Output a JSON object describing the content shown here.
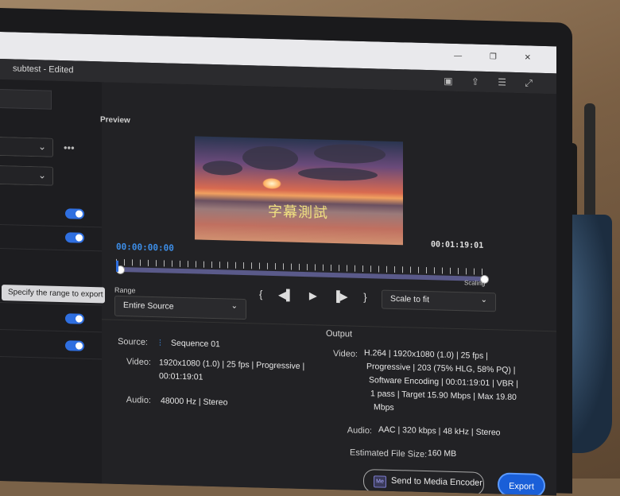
{
  "app": {
    "title": "subtest - Edited"
  },
  "preview": {
    "label": "Preview",
    "subtitle": "字幕測試",
    "timecode_current": "00:00:00:00",
    "timecode_duration": "00:01:19:01",
    "scaling_label": "Scaling"
  },
  "range": {
    "label": "Range",
    "value": "Entire Source"
  },
  "scale": {
    "value": "Scale to fit"
  },
  "tooltip": "Specify the range to export",
  "source": {
    "source_label": "Source:",
    "sequence": "Sequence 01",
    "video_label": "Video:",
    "video_line1": "1920x1080 (1.0) | 25 fps | Progressive |",
    "video_line2": "00:01:19:01",
    "audio_label": "Audio:",
    "audio": "48000 Hz | Stereo"
  },
  "output": {
    "title": "Output",
    "video_label": "Video:",
    "video_lines": [
      "H.264 | 1920x1080 (1.0) | 25 fps |",
      "Progressive | 203 (75% HLG, 58% PQ) |",
      "Software Encoding | 00:01:19:01 | VBR |",
      "1 pass | Target 15.90 Mbps | Max 19.80",
      "Mbps"
    ],
    "audio_label": "Audio:",
    "audio": "AAC | 320 kbps | 48 kHz | Stereo",
    "filesize_label": "Estimated File Size:",
    "filesize": "160 MB"
  },
  "buttons": {
    "send_to_media_encoder": "Send to Media Encoder",
    "export": "Export",
    "me_badge": "Me"
  },
  "sidebar": {
    "more": "•••",
    "toggles": [
      true,
      true,
      false,
      true,
      true
    ]
  },
  "icons": {
    "window_controls": "— ❐ ✕",
    "app_icons": "▣ ⇪ ☰ ⤢"
  }
}
